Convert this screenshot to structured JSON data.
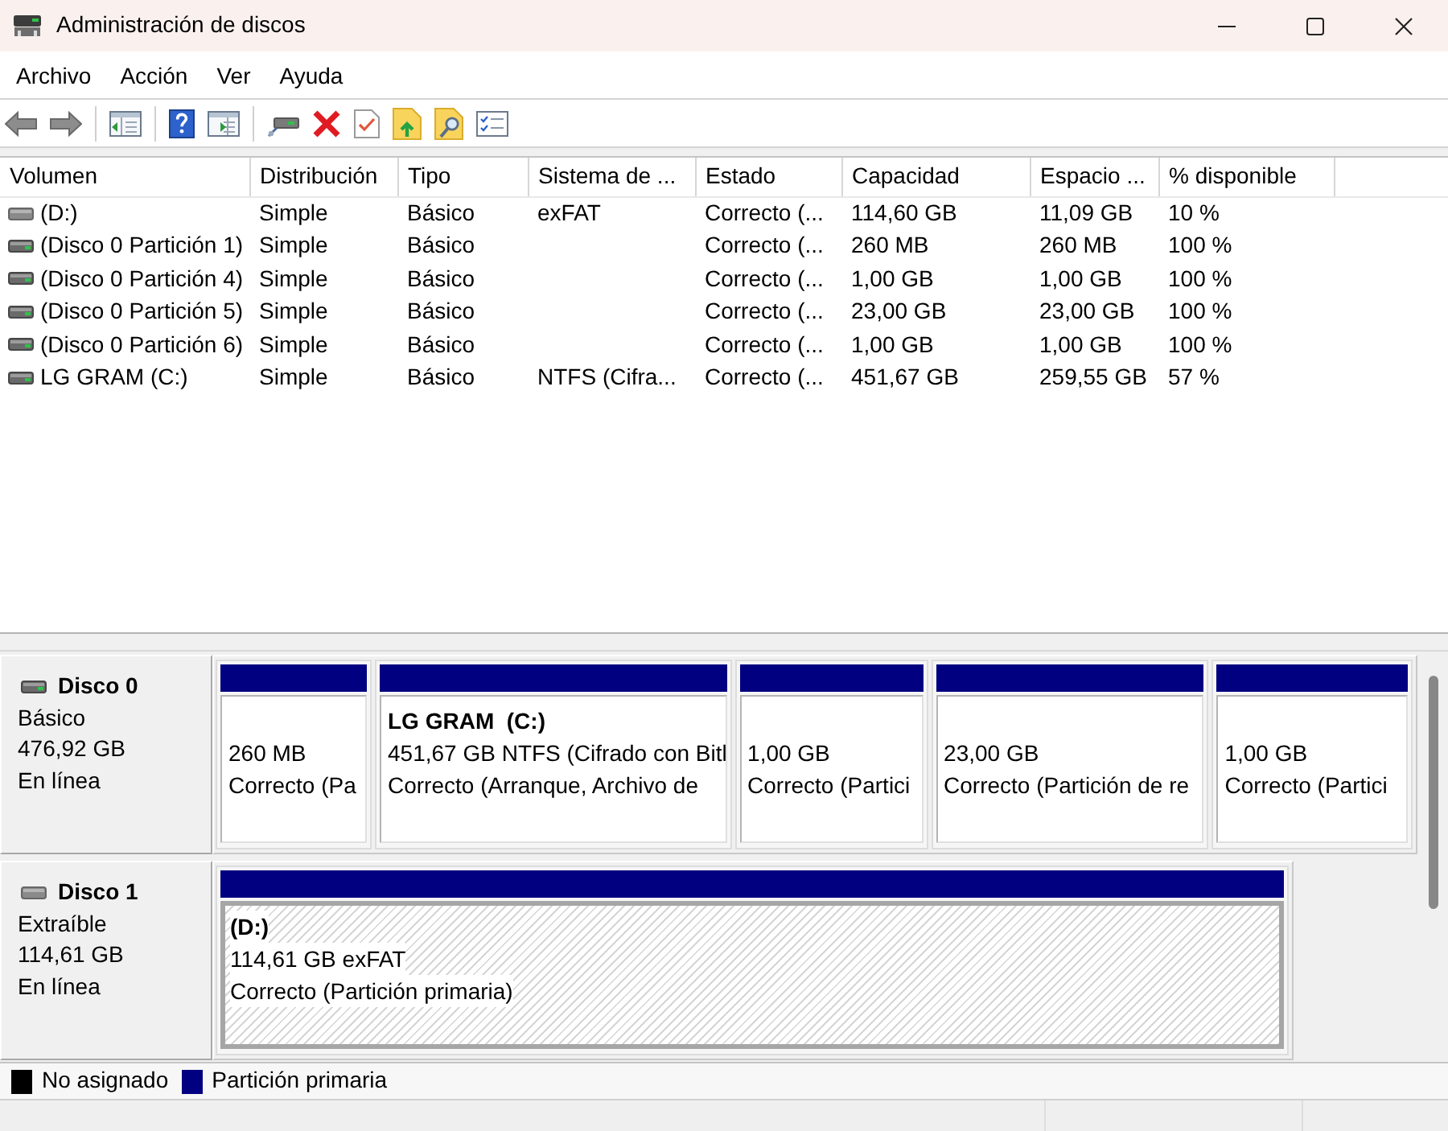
{
  "window": {
    "title": "Administración de discos"
  },
  "menu": [
    "Archivo",
    "Acción",
    "Ver",
    "Ayuda"
  ],
  "volume_list": {
    "columns": [
      "Volumen",
      "Distribución",
      "Tipo",
      "Sistema de ...",
      "Estado",
      "Capacidad",
      "Espacio ...",
      "% disponible"
    ],
    "rows": [
      {
        "kind": "removable",
        "cells": [
          "(D:)",
          "Simple",
          "Básico",
          "exFAT",
          "Correcto (...",
          "114,60 GB",
          "11,09 GB",
          "10 %"
        ]
      },
      {
        "kind": "fixed",
        "cells": [
          "(Disco 0 Partición 1)",
          "Simple",
          "Básico",
          "",
          "Correcto (...",
          "260 MB",
          "260 MB",
          "100 %"
        ]
      },
      {
        "kind": "fixed",
        "cells": [
          "(Disco 0 Partición 4)",
          "Simple",
          "Básico",
          "",
          "Correcto (...",
          "1,00 GB",
          "1,00 GB",
          "100 %"
        ]
      },
      {
        "kind": "fixed",
        "cells": [
          "(Disco 0 Partición 5)",
          "Simple",
          "Básico",
          "",
          "Correcto (...",
          "23,00 GB",
          "23,00 GB",
          "100 %"
        ]
      },
      {
        "kind": "fixed",
        "cells": [
          "(Disco 0 Partición 6)",
          "Simple",
          "Básico",
          "",
          "Correcto (...",
          "1,00 GB",
          "1,00 GB",
          "100 %"
        ]
      },
      {
        "kind": "fixed",
        "cells": [
          "LG GRAM (C:)",
          "Simple",
          "Básico",
          "NTFS (Cifra...",
          "Correcto (...",
          "451,67 GB",
          "259,55 GB",
          "57 %"
        ]
      }
    ]
  },
  "disks": [
    {
      "name": "Disco 0",
      "kind": "fixed",
      "type": "Básico",
      "size": "476,92 GB",
      "status": "En línea",
      "partitions": [
        {
          "size": "260 MB",
          "status": "Correcto (Pa",
          "selected": false
        },
        {
          "label": "LG GRAM  (C:)",
          "size": "451,67 GB NTFS (Cifrado con Bitl",
          "status": "Correcto (Arranque, Archivo de",
          "selected": false
        },
        {
          "size": "1,00 GB",
          "status": "Correcto (Partici",
          "selected": false
        },
        {
          "size": "23,00 GB",
          "status": "Correcto (Partición de re",
          "selected": false
        },
        {
          "size": "1,00 GB",
          "status": "Correcto (Partici",
          "selected": false
        }
      ]
    },
    {
      "name": "Disco 1",
      "kind": "removable",
      "type": "Extraíble",
      "size": "114,61 GB",
      "status": "En línea",
      "partitions": [
        {
          "label": "(D:)",
          "size": "114,61 GB exFAT",
          "status": "Correcto (Partición primaria)",
          "selected": true
        }
      ]
    }
  ],
  "legend": [
    {
      "label": "No asignado",
      "color": "#000000"
    },
    {
      "label": "Partición primaria",
      "color": "#000080"
    }
  ]
}
